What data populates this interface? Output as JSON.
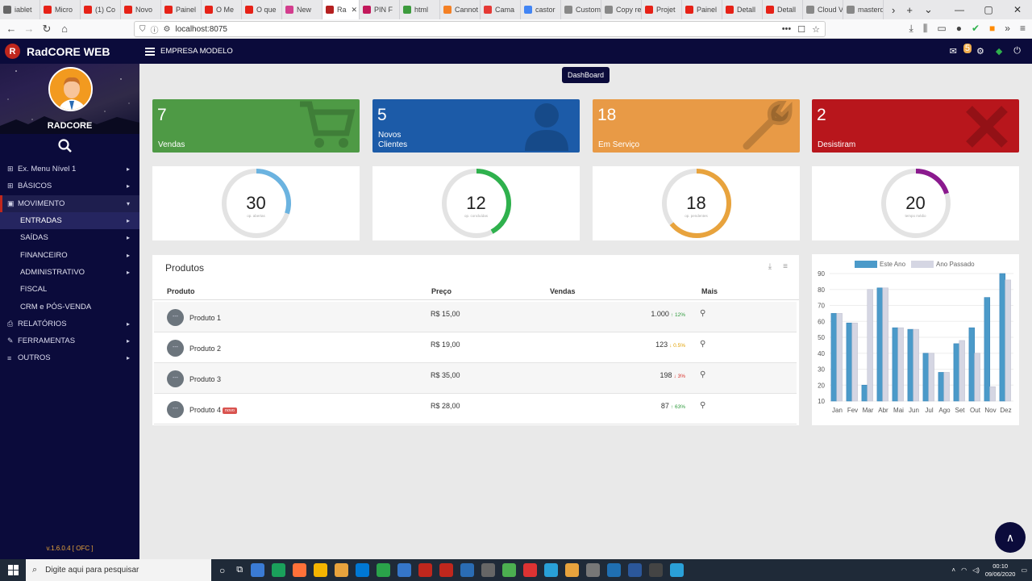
{
  "browser": {
    "tabs": [
      {
        "label": "iablet",
        "color": "#666666"
      },
      {
        "label": "Micro",
        "color": "#e62117"
      },
      {
        "label": "(1) Co",
        "color": "#e62117"
      },
      {
        "label": "Novo",
        "color": "#e62117"
      },
      {
        "label": "Painel",
        "color": "#e62117"
      },
      {
        "label": "O Me",
        "color": "#e62117"
      },
      {
        "label": "O que",
        "color": "#e62117"
      },
      {
        "label": "New",
        "color": "#d33d8e"
      },
      {
        "label": "Ra",
        "color": "#b52020",
        "active": true
      },
      {
        "label": "PIN F",
        "color": "#c2185b"
      },
      {
        "label": "html",
        "color": "#3d9b3d"
      },
      {
        "label": "Cannot",
        "color": "#f48024"
      },
      {
        "label": "Cama",
        "color": "#e53935"
      },
      {
        "label": "castor",
        "color": "#4285f4"
      },
      {
        "label": "Customer",
        "color": "#888888"
      },
      {
        "label": "Copy reco",
        "color": "#888888"
      },
      {
        "label": "Projet",
        "color": "#e62117"
      },
      {
        "label": "Painel",
        "color": "#e62117"
      },
      {
        "label": "Detall",
        "color": "#e62117"
      },
      {
        "label": "Detall",
        "color": "#e62117"
      },
      {
        "label": "Cloud VP",
        "color": "#888888"
      },
      {
        "label": "masterd",
        "color": "#888888"
      }
    ],
    "url": "localhost:8075"
  },
  "app": {
    "brand": "RadCORE WEB",
    "brand_letter": "R",
    "company": "EMPRESA MODELO",
    "username": "RADCORE",
    "version": "v.1.6.0.4 [ OFC ]",
    "mail_count": "5",
    "dashboard_label": "DashBoard"
  },
  "menu": [
    {
      "label": "Ex. Menu Nível 1",
      "icon": "sitemap-icon",
      "glyph": "⊞",
      "arrow": "▸"
    },
    {
      "label": "BÁSICOS",
      "icon": "sitemap-icon",
      "glyph": "⊞",
      "arrow": "▸"
    },
    {
      "label": "MOVIMENTO",
      "icon": "money-icon",
      "glyph": "▣",
      "arrow": "▾"
    },
    {
      "label": "ENTRADAS",
      "arrow": "▸"
    },
    {
      "label": "SAÍDAS",
      "arrow": "▸"
    },
    {
      "label": "FINANCEIRO",
      "arrow": "▸"
    },
    {
      "label": "ADMINISTRATIVO",
      "arrow": "▸"
    },
    {
      "label": "FISCAL",
      "arrow": ""
    },
    {
      "label": "CRM e PÓS-VENDA",
      "arrow": ""
    },
    {
      "label": "RELATÓRIOS",
      "icon": "print-icon",
      "glyph": "⎙",
      "arrow": "▸"
    },
    {
      "label": "FERRAMENTAS",
      "icon": "wrench-icon",
      "glyph": "✎",
      "arrow": "▸"
    },
    {
      "label": "OUTROS",
      "icon": "list-icon",
      "glyph": "≡",
      "arrow": "▸"
    }
  ],
  "cards": [
    {
      "value": "7",
      "label": "Vendas",
      "color": "#4e9a45",
      "icon": "cart-icon"
    },
    {
      "value": "5",
      "label": "Novos Clientes",
      "color": "#1c5ba8",
      "icon": "user-icon"
    },
    {
      "value": "18",
      "label": "Em Serviço",
      "color": "#e89a46",
      "icon": "wrench-icon"
    },
    {
      "value": "2",
      "label": "Desistiram",
      "color": "#b8161c",
      "icon": "close-icon"
    }
  ],
  "gauges": [
    {
      "value": "30",
      "sub": "op. abertas",
      "fraction": 0.3,
      "color": "#6bb3e0"
    },
    {
      "value": "12",
      "sub": "op. concluídas",
      "fraction": 0.42,
      "color": "#2fb14d"
    },
    {
      "value": "18",
      "sub": "op. pendentes",
      "fraction": 0.64,
      "color": "#e8a33d"
    },
    {
      "value": "20",
      "sub": "tempo médio",
      "fraction": 0.2,
      "color": "#8b1a8e"
    }
  ],
  "products": {
    "title": "Produtos",
    "headers": {
      "produto": "Produto",
      "preco": "Preço",
      "vendas": "Vendas",
      "mais": "Mais"
    },
    "avatar_text": "---",
    "badge_new": "novo",
    "rows": [
      {
        "name": "Produto 1",
        "price": "R$ 15,00",
        "sales": "1.000",
        "trend": "12%",
        "arrow": "↑",
        "trend_color": "#2e9a3c",
        "is_new": false
      },
      {
        "name": "Produto 2",
        "price": "R$ 19,00",
        "sales": "123",
        "trend": "0.5%",
        "arrow": "↓",
        "trend_color": "#e0a000",
        "is_new": false
      },
      {
        "name": "Produto 3",
        "price": "R$ 35,00",
        "sales": "198",
        "trend": "3%",
        "arrow": "↓",
        "trend_color": "#d9322a",
        "is_new": false
      },
      {
        "name": "Produto 4",
        "price": "R$ 28,00",
        "sales": "87",
        "trend": "63%",
        "arrow": "↑",
        "trend_color": "#2e9a3c",
        "is_new": true
      }
    ]
  },
  "chart_data": {
    "type": "bar",
    "categories": [
      "Jan",
      "Fev",
      "Mar",
      "Abr",
      "Mai",
      "Jun",
      "Jul",
      "Ago",
      "Set",
      "Out",
      "Nov",
      "Dez"
    ],
    "series": [
      {
        "name": "Este Ano",
        "color": "#4b9ac9",
        "values": [
          65,
          59,
          20,
          81,
          56,
          55,
          40,
          28,
          46,
          56,
          75,
          90
        ]
      },
      {
        "name": "Ano Passado",
        "color": "#d5d6e3",
        "values": [
          65,
          59,
          80,
          81,
          56,
          55,
          40,
          28,
          48,
          40,
          19,
          86
        ]
      }
    ],
    "yticks": [
      10,
      20,
      30,
      40,
      50,
      60,
      70,
      80,
      90
    ],
    "ylim": [
      10,
      90
    ],
    "legend": "top"
  },
  "taskbar": {
    "search_placeholder": "Digite aqui para pesquisar",
    "time": "00:10",
    "date": "09/06/2020",
    "icons": [
      "#3a7bd5",
      "#1aa05b",
      "#ff7139",
      "#f4b400",
      "#e8a33d",
      "#0078d4",
      "#2aa34a",
      "#3576c9",
      "#c0271d",
      "#c0271d",
      "#2a6cb4",
      "#666666",
      "#4caf50",
      "#d33",
      "#29a0d8",
      "#e8a33d",
      "#777777",
      "#1f6fb2",
      "#2b579a",
      "#444444",
      "#2aa0d8"
    ]
  }
}
